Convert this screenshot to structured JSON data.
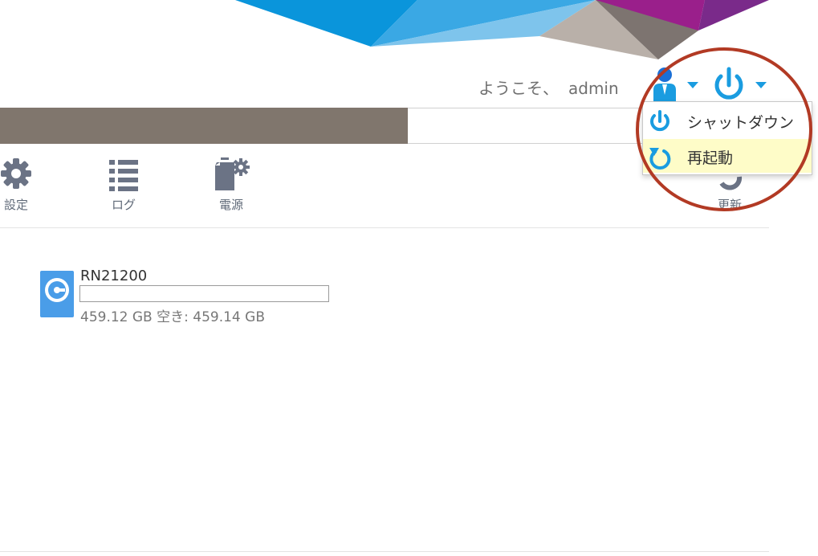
{
  "header": {
    "welcome_text": "ようこそ、",
    "username": "admin"
  },
  "toolbar": {
    "items": [
      {
        "label": "設定",
        "icon": "gear-icon"
      },
      {
        "label": "ログ",
        "icon": "list-icon"
      },
      {
        "label": "電源",
        "icon": "power-settings-icon"
      },
      {
        "label": "更新",
        "icon": "refresh-icon"
      }
    ]
  },
  "volume": {
    "name": "RN21200",
    "usage_fraction": 0.0,
    "free_text": "459.12 GB 空き: 459.14 GB"
  },
  "power_menu": {
    "items": [
      {
        "label": "シャットダウン",
        "icon": "power-icon",
        "highlighted": false
      },
      {
        "label": "再起動",
        "icon": "restart-icon",
        "highlighted": true
      }
    ]
  },
  "colors": {
    "accent": "#1a9ce0",
    "navbar": "#80766d",
    "highlight": "#fefcc8",
    "annotation_circle": "#b23a24"
  }
}
